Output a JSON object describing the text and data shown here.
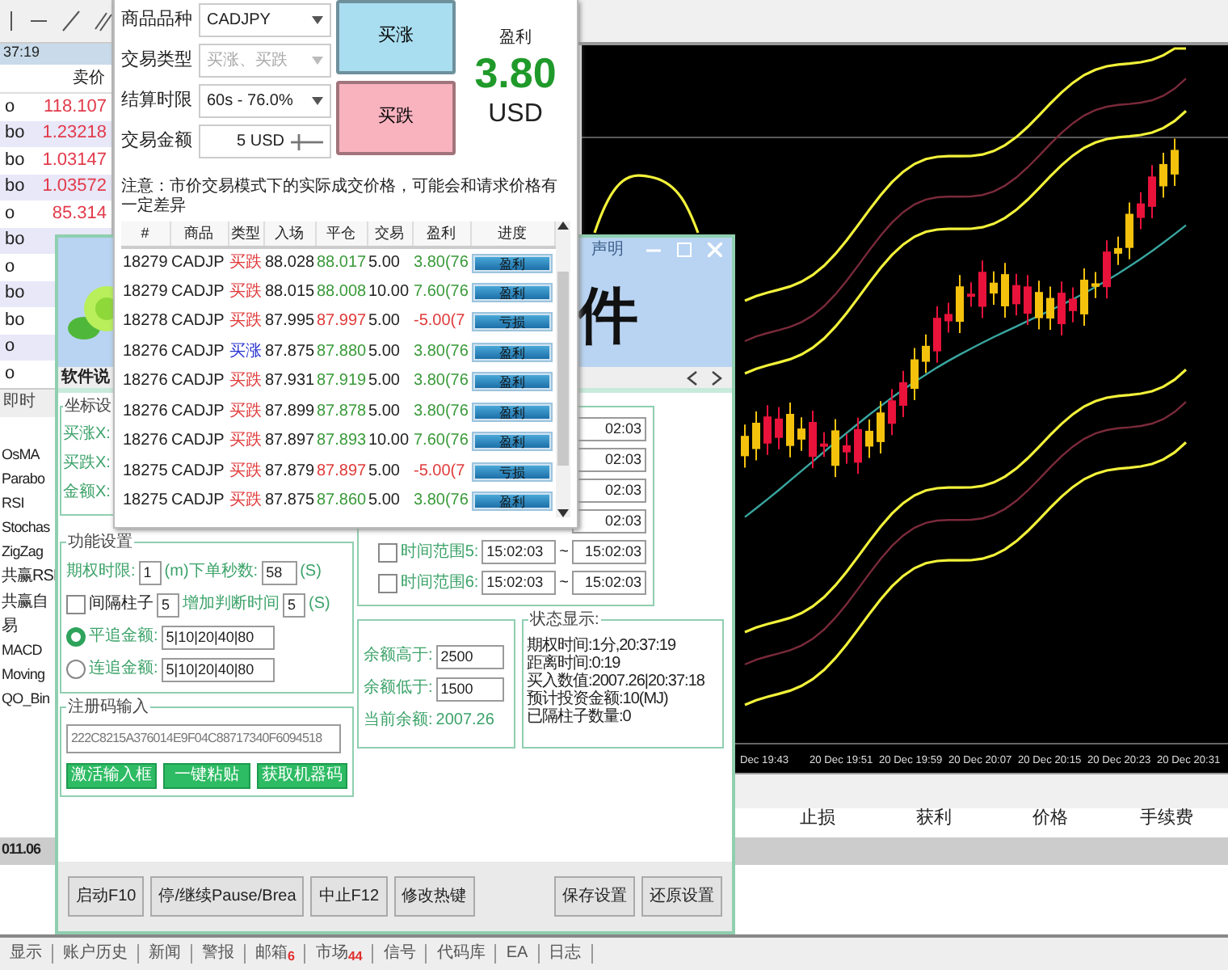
{
  "market_watch": {
    "time": "37:19",
    "column_header": "卖价",
    "rows": [
      {
        "symbol": "o",
        "bid": "118.107"
      },
      {
        "symbol": "bo",
        "bid": "1.23218"
      },
      {
        "symbol": "bo",
        "bid": "1.03147"
      },
      {
        "symbol": "bo",
        "bid": "1.03572"
      },
      {
        "symbol": "o",
        "bid": "85.314"
      },
      {
        "symbol": "bo"
      },
      {
        "symbol": "o"
      },
      {
        "symbol": "bo"
      },
      {
        "symbol": "bo"
      },
      {
        "symbol": "o"
      },
      {
        "symbol": "o"
      }
    ]
  },
  "market_tabs": [
    {
      "label": "即时",
      "selected": true
    }
  ],
  "navigator": {
    "items": [
      "OsMA",
      "Parabo",
      "RSI",
      "Stochas",
      "ZigZag",
      "共赢RSI",
      "共赢自",
      "易",
      "MACD",
      "Moving",
      "QO_Bin"
    ]
  },
  "chart": {
    "time_labels": [
      "Dec 19:43",
      "20 Dec 19:51",
      "20 Dec 19:59",
      "20 Dec 20:07",
      "20 Dec 20:15",
      "20 Dec 20:23",
      "20 Dec 20:31"
    ]
  },
  "terminal": {
    "balance": "011.06",
    "columns": [
      "止损",
      "获利",
      "价格",
      "手续费"
    ]
  },
  "bottom_tabs": [
    {
      "label": "显示"
    },
    {
      "label": "账户历史"
    },
    {
      "label": "新闻"
    },
    {
      "label": "警报"
    },
    {
      "label": "邮箱",
      "count": "6"
    },
    {
      "label": "市场",
      "count": "44"
    },
    {
      "label": "信号"
    },
    {
      "label": "代码库"
    },
    {
      "label": "EA"
    },
    {
      "label": "日志"
    }
  ],
  "trade_panel": {
    "fields": [
      {
        "label": "商品品种",
        "kind": "select",
        "value": "CADJPY",
        "disabled": false
      },
      {
        "label": "交易类型",
        "kind": "select",
        "value": "买涨、买跌",
        "disabled": true
      },
      {
        "label": "结算时限",
        "kind": "select",
        "value": "60s - 76.0%",
        "disabled": false
      },
      {
        "label": "交易金额",
        "kind": "amount",
        "value": "5 USD"
      }
    ],
    "buttons": [
      {
        "label": "买涨",
        "color": "#a9def0"
      },
      {
        "label": "买跌",
        "color": "#f8b3bf"
      }
    ],
    "profit": {
      "label": "盈利",
      "value": "3.80",
      "currency": "USD"
    },
    "notice": "注意：市价交易模式下的实际成交价格，可能会和请求价格有一定差异",
    "table": {
      "columns": [
        "#",
        "商品",
        "类型",
        "入场",
        "平仓",
        "交易",
        "盈利",
        "进度"
      ],
      "rows": [
        {
          "id": "18279",
          "symbol": "CADJP",
          "type": {
            "text": "买跌",
            "color": "#e03a3a"
          },
          "entry": "88.028",
          "close": {
            "text": "88.017",
            "color": "#3a9a3a"
          },
          "amount": "5.00",
          "profit": {
            "text": "3.80(76",
            "color": "#3a9a3a"
          },
          "progress": {
            "label": "盈利",
            "level": 1
          }
        },
        {
          "id": "18279",
          "symbol": "CADJP",
          "type": {
            "text": "买跌",
            "color": "#e03a3a"
          },
          "entry": "88.015",
          "close": {
            "text": "88.008",
            "color": "#3a9a3a"
          },
          "amount": "10.00",
          "profit": {
            "text": "7.60(76",
            "color": "#3a9a3a"
          },
          "progress": {
            "label": "盈利",
            "level": 1
          }
        },
        {
          "id": "18278",
          "symbol": "CADJP",
          "type": {
            "text": "买跌",
            "color": "#e03a3a"
          },
          "entry": "87.995",
          "close": {
            "text": "87.997",
            "color": "#e03a3a"
          },
          "amount": "5.00",
          "profit": {
            "text": "-5.00(7",
            "color": "#e03a3a"
          },
          "progress": {
            "label": "亏损",
            "level": 1
          }
        },
        {
          "id": "18276",
          "symbol": "CADJP",
          "type": {
            "text": "买涨",
            "color": "#2a34d0"
          },
          "entry": "87.875",
          "close": {
            "text": "87.880",
            "color": "#3a9a3a"
          },
          "amount": "5.00",
          "profit": {
            "text": "3.80(76",
            "color": "#3a9a3a"
          },
          "progress": {
            "label": "盈利",
            "level": 1
          }
        },
        {
          "id": "18276",
          "symbol": "CADJP",
          "type": {
            "text": "买跌",
            "color": "#e03a3a"
          },
          "entry": "87.931",
          "close": {
            "text": "87.919",
            "color": "#3a9a3a"
          },
          "amount": "5.00",
          "profit": {
            "text": "3.80(76",
            "color": "#3a9a3a"
          },
          "progress": {
            "label": "盈利",
            "level": 1
          }
        },
        {
          "id": "18276",
          "symbol": "CADJP",
          "type": {
            "text": "买跌",
            "color": "#e03a3a"
          },
          "entry": "87.899",
          "close": {
            "text": "87.878",
            "color": "#3a9a3a"
          },
          "amount": "5.00",
          "profit": {
            "text": "3.80(76",
            "color": "#3a9a3a"
          },
          "progress": {
            "label": "盈利",
            "level": 1
          }
        },
        {
          "id": "18276",
          "symbol": "CADJP",
          "type": {
            "text": "买跌",
            "color": "#e03a3a"
          },
          "entry": "87.897",
          "close": {
            "text": "87.893",
            "color": "#3a9a3a"
          },
          "amount": "10.00",
          "profit": {
            "text": "7.60(76",
            "color": "#3a9a3a"
          },
          "progress": {
            "label": "盈利",
            "level": 1
          }
        },
        {
          "id": "18275",
          "symbol": "CADJP",
          "type": {
            "text": "买跌",
            "color": "#e03a3a"
          },
          "entry": "87.879",
          "close": {
            "text": "87.897",
            "color": "#e03a3a"
          },
          "amount": "5.00",
          "profit": {
            "text": "-5.00(7",
            "color": "#e03a3a"
          },
          "progress": {
            "label": "亏损",
            "level": 1
          }
        },
        {
          "id": "18275",
          "symbol": "CADJP",
          "type": {
            "text": "买跌",
            "color": "#e03a3a"
          },
          "entry": "87.875",
          "close": {
            "text": "87.860",
            "color": "#3a9a3a"
          },
          "amount": "5.00",
          "profit": {
            "text": "3.80(76",
            "color": "#3a9a3a"
          },
          "progress": {
            "label": "盈利",
            "level": 1
          }
        }
      ]
    }
  },
  "plugin": {
    "title": "声明",
    "banner_text": "件",
    "tabs": [
      {
        "label": "软件说",
        "selected": true
      }
    ],
    "coords": {
      "title": "坐标设",
      "rows": [
        "买涨X:",
        "买跌X:",
        "金额X:"
      ]
    },
    "functions": {
      "title": "功能设置",
      "period_label": "期权时限:",
      "period": "1",
      "seconds_label": "(m)下单秒数:",
      "seconds": "58",
      "seconds_unit": "(S)",
      "interval": {
        "label": "间隔柱子",
        "checked": false,
        "value": "5"
      },
      "extra_label": "增加判断时间",
      "extra": "5",
      "extra_unit": "(S)",
      "modes": [
        {
          "label": "平追金额:",
          "value": "5|10|20|40|80",
          "selected": true
        },
        {
          "label": "连追金额:",
          "value": "5|10|20|40|80",
          "selected": false
        }
      ]
    },
    "time_ranges": [
      {
        "end": "02:03"
      },
      {
        "end": "02:03"
      },
      {
        "end": "02:03"
      },
      {
        "end": "02:03"
      },
      {
        "label": "时间范围5:",
        "checked": false,
        "start": "15:02:03",
        "separator": "~",
        "end": "15:02:03"
      },
      {
        "label": "时间范围6:",
        "checked": false,
        "start": "15:02:03",
        "separator": "~",
        "end": "15:02:03"
      }
    ],
    "balance": {
      "above_label": "余额高于:",
      "above": "2500",
      "below_label": "余额低于:",
      "below": "1500",
      "current_label": "当前余额:",
      "current": "2007.26"
    },
    "status": {
      "title": "状态显示:",
      "lines": [
        "期权时间:1分,20:37:19",
        "距离时间:0:19",
        "买入数值:2007.26|20:37:18",
        "预计投资金额:10(MJ)",
        "已隔柱子数量:0"
      ]
    },
    "registration": {
      "title": "注册码输入",
      "code": "222C8215A376014E9F04C88717340F6094518",
      "buttons": [
        "激活输入框",
        "一键粘贴",
        "获取机器码"
      ]
    },
    "footer_buttons": {
      "left": [
        "启动F10",
        "停/继续Pause/Brea",
        "中止F12",
        "修改热键"
      ],
      "right": [
        "保存设置",
        "还原设置"
      ]
    }
  }
}
